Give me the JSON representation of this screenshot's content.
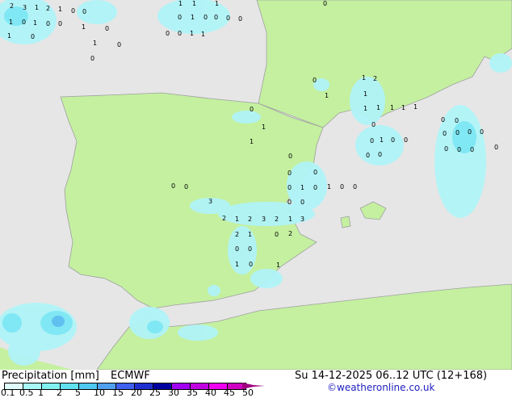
{
  "map": {
    "colors": {
      "sea": "#e6e6e6",
      "land": "#c4f0a0",
      "border": "#a0a0a0",
      "precip_light": "#b0f4f8",
      "precip_mid": "#80e8f4",
      "precip_heavy": "#60c0f0"
    },
    "labels": [
      "2",
      "3",
      "1",
      "2",
      "1",
      "0",
      "0",
      "1",
      "0",
      "1",
      "0",
      "0",
      "1",
      "0",
      "0",
      "1",
      "1",
      "0",
      "0",
      "1",
      "1",
      "1",
      "0",
      "1",
      "0",
      "0",
      "0",
      "0",
      "0",
      "0",
      "1",
      "1",
      "0",
      "0",
      "1",
      "1",
      "2",
      "1",
      "1",
      "1",
      "1",
      "1",
      "1",
      "0",
      "0",
      "0",
      "0",
      "0",
      "0",
      "0",
      "0",
      "0",
      "0",
      "0",
      "0",
      "1",
      "0",
      "0",
      "0",
      "0",
      "0",
      "1",
      "1",
      "0",
      "0",
      "0",
      "0",
      "1",
      "0",
      "1",
      "0",
      "0",
      "0",
      "0",
      "3",
      "2",
      "1",
      "2",
      "3",
      "2",
      "1",
      "3",
      "0",
      "0",
      "2",
      "1",
      "0",
      "2",
      "0",
      "0",
      "1",
      "0",
      "1"
    ]
  },
  "footer": {
    "title": "Precipitation [mm]",
    "model": "ECMWF",
    "datetime": "Su 14-12-2025 06..12 UTC (12+168)",
    "credit": "©weatheronline.co.uk",
    "scale_ticks": [
      "0.1",
      "0.5",
      "1",
      "2",
      "5",
      "10",
      "15",
      "20",
      "25",
      "30",
      "35",
      "40",
      "45",
      "50"
    ],
    "scale_colors": [
      "#e0fcfc",
      "#a8f8f8",
      "#80f0f0",
      "#60e0f0",
      "#50c8f0",
      "#50a0f0",
      "#4060f0",
      "#2030d0",
      "#0000a0",
      "#a000f0",
      "#c000e0",
      "#f000f0",
      "#d000c0"
    ],
    "arrow_color": "#a00080"
  }
}
